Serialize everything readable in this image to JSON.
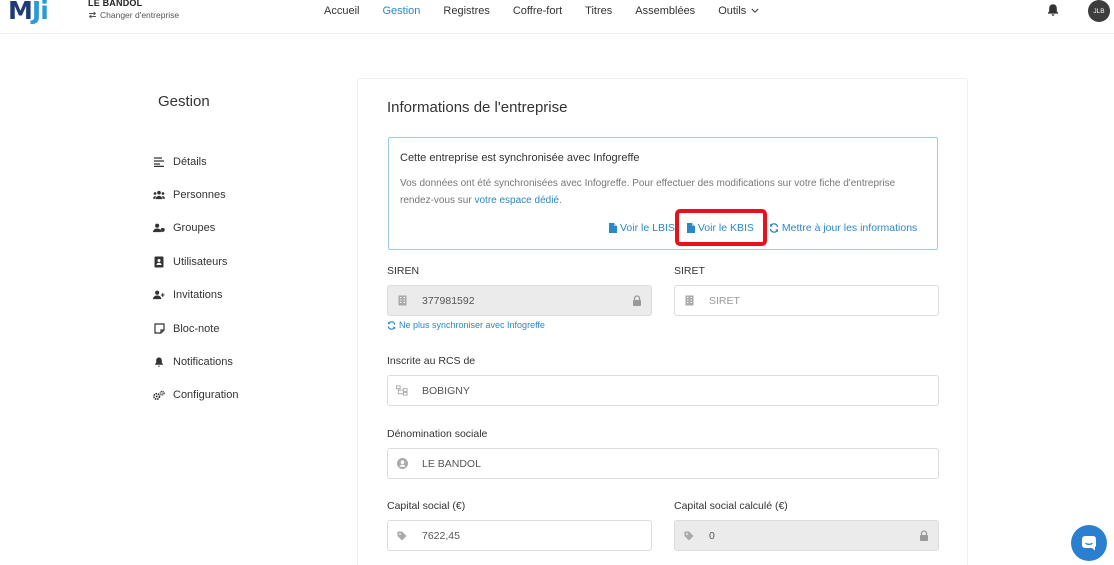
{
  "header": {
    "logo": {
      "main": "M",
      "accent": "J",
      "tail": "i"
    },
    "company_name": "LE BANDOL",
    "switch_label": "Changer d'entreprise",
    "nav": [
      "Accueil",
      "Gestion",
      "Registres",
      "Coffre-fort",
      "Titres",
      "Assemblées",
      "Outils"
    ],
    "active_nav": "Gestion",
    "avatar_initials": "JLB"
  },
  "sidebar": {
    "title": "Gestion",
    "items": [
      {
        "label": "Détails",
        "icon": "lines-icon"
      },
      {
        "label": "Personnes",
        "icon": "people-icon"
      },
      {
        "label": "Groupes",
        "icon": "group-icon"
      },
      {
        "label": "Utilisateurs",
        "icon": "id-card-icon"
      },
      {
        "label": "Invitations",
        "icon": "user-plus-icon"
      },
      {
        "label": "Bloc-note",
        "icon": "note-icon"
      },
      {
        "label": "Notifications",
        "icon": "bell-icon"
      },
      {
        "label": "Configuration",
        "icon": "cogs-icon"
      }
    ]
  },
  "main": {
    "title": "Informations de l'entreprise",
    "sync": {
      "title": "Cette entreprise est synchronisée avec Infogreffe",
      "text": "Vos données ont été synchronisées avec Infogreffe. Pour effectuer des modifications sur votre fiche d'entreprise rendez-vous sur",
      "link": "votre espace dédié",
      "after_link": ".",
      "actions": {
        "lbis": "Voir le LBIS",
        "kbis": "Voir le KBIS",
        "update": "Mettre à jour les informations"
      }
    },
    "fields": {
      "siren": {
        "label": "SIREN",
        "value": "377981592"
      },
      "siret": {
        "label": "SIRET",
        "placeholder": "SIRET"
      },
      "unsync_link": "Ne plus synchroniser avec Infogreffe",
      "rcs": {
        "label": "Inscrite au RCS de",
        "value": "BOBIGNY"
      },
      "denomination": {
        "label": "Dénomination sociale",
        "value": "LE BANDOL"
      },
      "capital": {
        "label": "Capital social (€)",
        "value": "7622,45"
      },
      "capital_calc": {
        "label": "Capital social calculé (€)",
        "value": "0"
      }
    }
  },
  "colors": {
    "accent": "#2a88c8",
    "logo_dark": "#1f3a7a",
    "highlight": "#e8101c",
    "sync_border": "#9ec9ea"
  }
}
